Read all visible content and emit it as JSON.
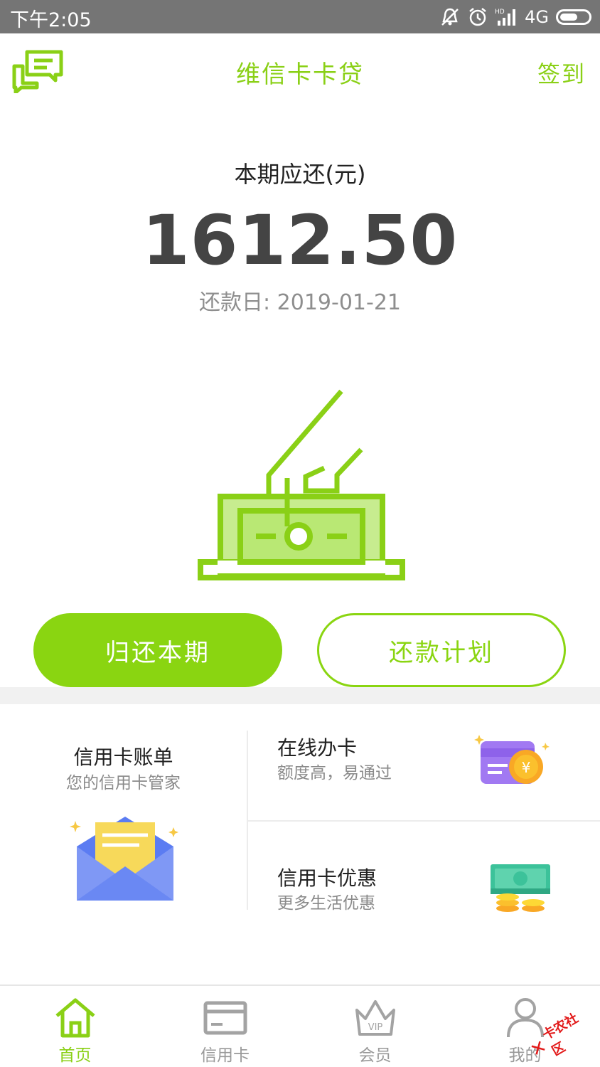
{
  "status_bar": {
    "time": "下午2:05",
    "network": "4G",
    "signal_label": "HD",
    "icons": [
      "mute-icon",
      "alarm-icon",
      "signal-icon",
      "battery-icon"
    ]
  },
  "header": {
    "title": "维信卡卡贷",
    "sign_in": "签到",
    "icon": "chat-icon"
  },
  "bill": {
    "label": "本期应还(元)",
    "amount": "1612.50",
    "due_prefix": "还款日: ",
    "due_date": "2019-01-21"
  },
  "actions": {
    "repay": "归还本期",
    "plan": "还款计划"
  },
  "features": {
    "bill": {
      "title": "信用卡账单",
      "subtitle": "您的信用卡管家",
      "icon": "envelope-icon"
    },
    "online": {
      "title": "在线办卡",
      "subtitle": "额度高，易通过",
      "icon": "credit-card-coin-icon"
    },
    "promo": {
      "title": "信用卡优惠",
      "subtitle": "更多生活优惠",
      "icon": "cash-coins-icon"
    }
  },
  "nav": [
    {
      "label": "首页",
      "icon": "home-icon",
      "active": true
    },
    {
      "label": "信用卡",
      "icon": "card-icon",
      "active": false
    },
    {
      "label": "会员",
      "icon": "vip-crown-icon",
      "active": false
    },
    {
      "label": "我的",
      "icon": "user-icon",
      "active": false
    }
  ],
  "watermark": {
    "text": "卡农社区"
  },
  "colors": {
    "accent": "#8ad511",
    "text": "#222222",
    "muted": "#8a8a8a",
    "status_bar": "#757575"
  }
}
